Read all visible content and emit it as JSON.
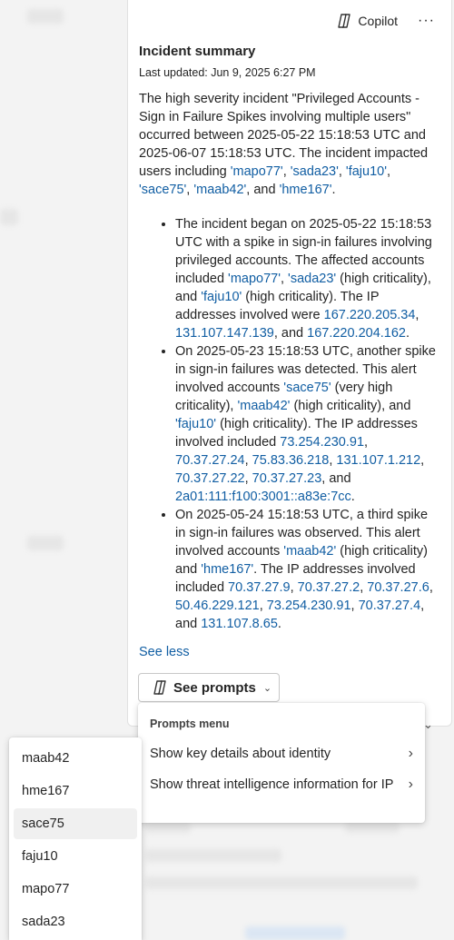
{
  "header": {
    "copilot_label": "Copilot",
    "more_label": "···"
  },
  "incident": {
    "title": "Incident summary",
    "last_updated": "Last updated: Jun 9, 2025 6:27 PM",
    "summary": {
      "t1": "The high severity incident \"Privileged Accounts - Sign in Failure Spikes involving multiple users\" occurred between 2025-05-22 15:18:53 UTC and 2025-06-07 15:18:53 UTC. The incident impacted users including ",
      "u1": "'mapo77'",
      "s1": ", ",
      "u2": "'sada23'",
      "s2": ", ",
      "u3": "'faju10'",
      "s3": ", ",
      "u4": "'sace75'",
      "s4": ", ",
      "u5": "'maab42'",
      "s5": ", and ",
      "u6": "'hme167'",
      "s6": "."
    },
    "events": [
      {
        "t1": "The incident began on 2025-05-22 15:18:53 UTC with a spike in sign-in failures involving privileged accounts. The affected accounts included ",
        "a1": "'mapo77'",
        "t2": ", ",
        "a2": "'sada23'",
        "t3": " (high criticality), and ",
        "a3": "'faju10'",
        "t4": " (high criticality). The IP addresses involved were ",
        "ip1": "167.220.205.34",
        "t5": ", ",
        "ip2": "131.107.147.139",
        "t6": ", and ",
        "ip3": "167.220.204.162",
        "t7": "."
      },
      {
        "t1": "On 2025-05-23 15:18:53 UTC, another spike in sign-in failures was detected. This alert involved accounts ",
        "a1": "'sace75'",
        "t2": " (very high criticality), ",
        "a2": "'maab42'",
        "t3": " (high criticality), and ",
        "a3": "'faju10'",
        "t4": " (high criticality). The IP addresses involved included ",
        "ip1": "73.254.230.91",
        "t5": ", ",
        "ip2": "70.37.27.24",
        "t6": ", ",
        "ip3": "75.83.36.218",
        "t7": ", ",
        "ip4": "131.107.1.212",
        "t8": ", ",
        "ip5": "70.37.27.22",
        "t9": ", ",
        "ip6": "70.37.27.23",
        "t10": ", and ",
        "ip7": "2a01:111:f100:3001::a83e:7cc",
        "t11": "."
      },
      {
        "t1": "On 2025-05-24 15:18:53 UTC, a third spike in sign-in failures was observed. This alert involved accounts ",
        "a1": "'maab42'",
        "t2": " (high criticality) and ",
        "a2": "'hme167'",
        "t3": ". The IP addresses involved included ",
        "ip1": "70.37.27.9",
        "t4": ", ",
        "ip2": "70.37.27.2",
        "t5": ", ",
        "ip3": "70.37.27.6",
        "t6": ", ",
        "ip4": "50.46.229.121",
        "t7": ", ",
        "ip5": "73.254.230.91",
        "t8": ", ",
        "ip6": "70.37.27.4",
        "t9": ", and ",
        "ip7": "131.107.8.65",
        "t10": "."
      }
    ],
    "see_less": "See less",
    "see_prompts": "See prompts"
  },
  "prompts_menu": {
    "heading": "Prompts menu",
    "items": [
      {
        "label": "Show key details about identity"
      },
      {
        "label": "Show threat intelligence information for IP"
      }
    ]
  },
  "identity_list": {
    "items": [
      "maab42",
      "hme167",
      "sace75",
      "faju10",
      "mapo77",
      "sada23"
    ],
    "hovered": "sace75"
  },
  "colors": {
    "link": "#115ea3",
    "hover": "#f0f0f0"
  },
  "icons": [
    "copilot-icon",
    "more-icon",
    "chevron-down-icon",
    "chevron-right-icon"
  ]
}
